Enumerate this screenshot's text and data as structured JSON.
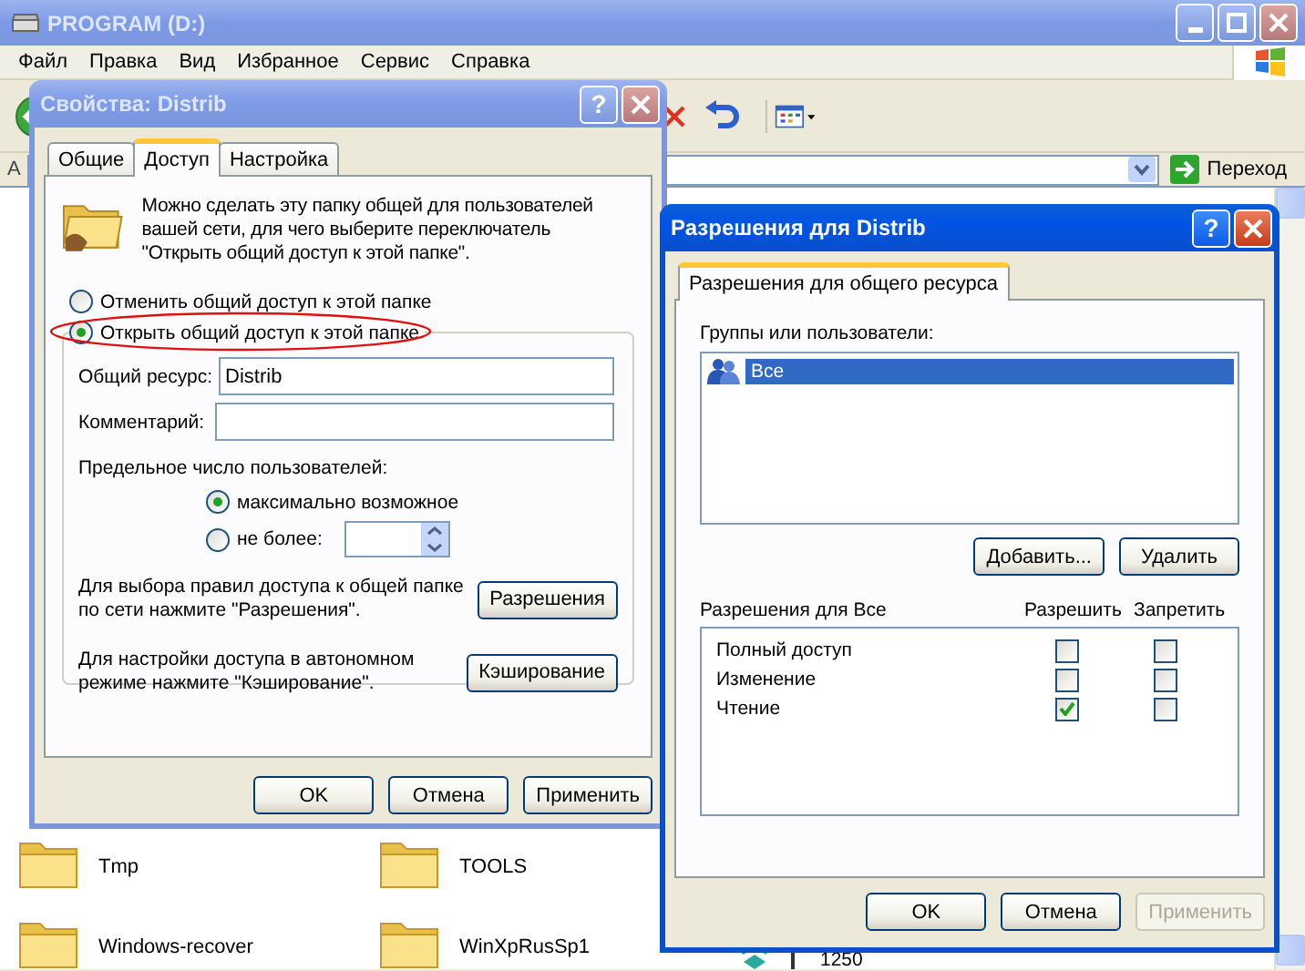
{
  "explorer": {
    "title": "PROGRAM (D:)",
    "active": false,
    "menu": [
      "Файл",
      "Правка",
      "Вид",
      "Избранное",
      "Сервис",
      "Справка"
    ],
    "address_label": "А",
    "go_button": "Переход",
    "files": [
      {
        "kind": "folder",
        "label": "Tmp"
      },
      {
        "kind": "folder",
        "label": "TOOLS"
      },
      {
        "kind": "folder",
        "label": "Windows-recover"
      },
      {
        "kind": "folder",
        "label": "WinXpRusSp1"
      },
      {
        "kind": "registry",
        "label": "1250"
      }
    ]
  },
  "properties_dialog": {
    "title": "Свойства: Distrib",
    "active": false,
    "help_button": "?",
    "tabs": [
      {
        "label": "Общие",
        "selected": false
      },
      {
        "label": "Доступ",
        "selected": true
      },
      {
        "label": "Настройка",
        "selected": false
      }
    ],
    "intro": "Можно сделать эту папку общей для пользователей вашей сети, для чего выберите переключатель \"Открыть общий доступ к этой папке\".",
    "radios": [
      {
        "label": "Отменить общий доступ к этой папке",
        "selected": false,
        "circled": false
      },
      {
        "label": "Открыть общий доступ к этой папке",
        "selected": true,
        "circled": true
      }
    ],
    "share_name": {
      "label": "Общий ресурс:",
      "value": "Distrib"
    },
    "comment": {
      "label": "Комментарий:"
    },
    "user_limit": {
      "label": "Предельное число пользователей:",
      "options": [
        {
          "label": "максимально возможное",
          "selected": true
        },
        {
          "label": "не более:",
          "selected": false
        }
      ]
    },
    "actions": [
      {
        "text": "Для выбора правил доступа к общей папке по сети нажмите \"Разрешения\".",
        "button": "Разрешения"
      },
      {
        "text": "Для настройки доступа в автономном режиме нажмите \"Кэширование\".",
        "button": "Кэширование"
      }
    ],
    "buttons": [
      {
        "label": "OK",
        "disabled": false
      },
      {
        "label": "Отмена",
        "disabled": false
      },
      {
        "label": "Применить",
        "disabled": false
      }
    ]
  },
  "permissions_dialog": {
    "title": "Разрешения для Distrib",
    "active": true,
    "help_button": "?",
    "tabs": [
      {
        "label": "Разрешения для общего ресурса",
        "selected": true
      }
    ],
    "groups_label": "Группы или пользователи:",
    "users": [
      {
        "name": "Все",
        "selected": true
      }
    ],
    "user_buttons": [
      "Добавить...",
      "Удалить"
    ],
    "permissions_label": "Разрешения для Все",
    "allow_header": "Разрешить",
    "deny_header": "Запретить",
    "permissions": [
      {
        "name": "Полный доступ",
        "allow": false,
        "deny": false
      },
      {
        "name": "Изменение",
        "allow": false,
        "deny": false
      },
      {
        "name": "Чтение",
        "allow": true,
        "deny": false
      }
    ],
    "buttons": [
      {
        "label": "OK",
        "disabled": false
      },
      {
        "label": "Отмена",
        "disabled": false
      },
      {
        "label": "Применить",
        "disabled": true
      }
    ]
  }
}
